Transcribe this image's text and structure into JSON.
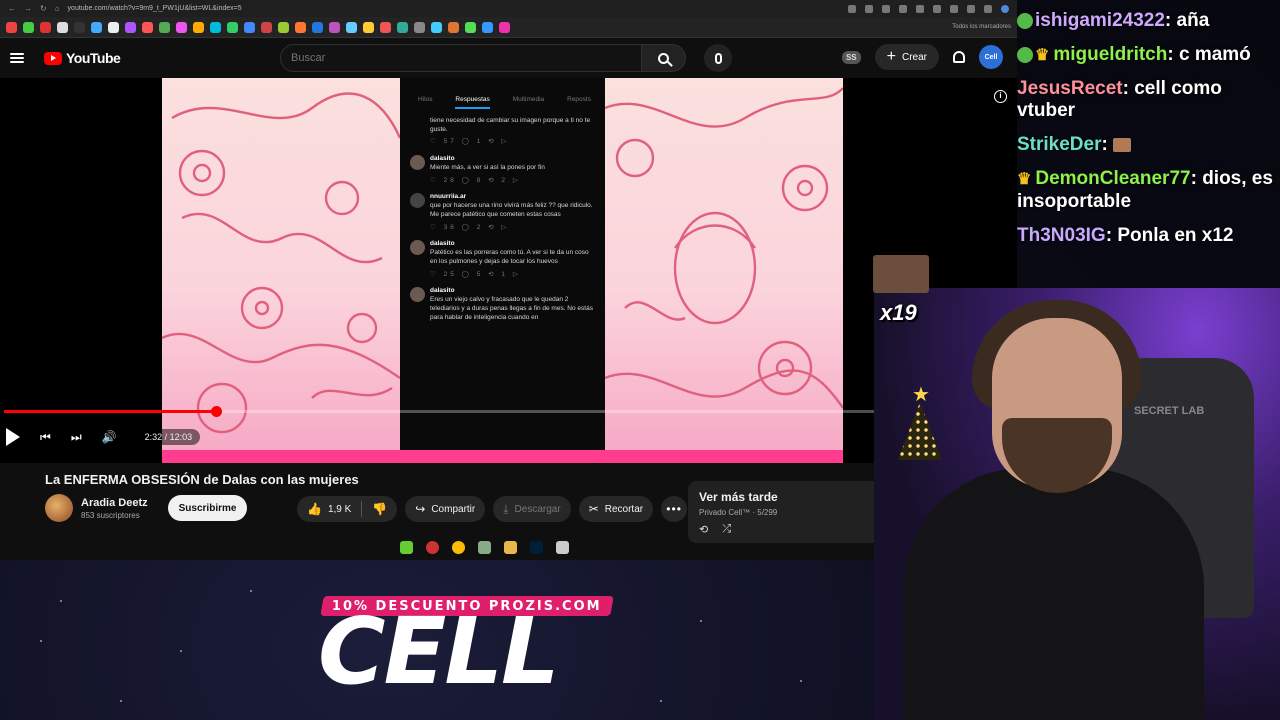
{
  "browser": {
    "url": "youtube.com/watch?v=9m9_t_PW1jU&list=WL&index=5",
    "bookmarks_all": "Todos los marcadores"
  },
  "yt": {
    "logo_text": "YouTube",
    "search_placeholder": "Buscar",
    "ss_badge": "SS",
    "create_label": "Crear",
    "avatar_text": "Cell"
  },
  "player": {
    "time": "2:32 / 12:03",
    "progress": 0.21
  },
  "tweet_panel": {
    "tabs": [
      "Hilos",
      "Respuestas",
      "Multimedia",
      "Reposts"
    ],
    "posts": [
      {
        "handle": "",
        "text": "tiene necesidad de cambiar su imagen porque a ti no te guste.",
        "acts": "♡ 57  ◯ 1  ⟲  ▷"
      },
      {
        "handle": "dalasito",
        "text": "Miente más, a ver si así la pones por fin",
        "acts": "♡ 28  ◯ 8  ⟲ 2  ▷"
      },
      {
        "handle": "nnuurriia.ar",
        "text": "que por hacerse una rino vivirá más feliz ?? que ridiculo. Me parece patético que cometen estas cosas",
        "acts": "♡ 36  ◯ 2  ⟲  ▷"
      },
      {
        "handle": "dalasito",
        "text": "Patético es las porreras como tú. A ver si te da un coso en los pulmones y dejas de tocar los huevos",
        "acts": "♡ 25  ◯ 5  ⟲ 1  ▷"
      },
      {
        "handle": "dalasito",
        "text": "Eres un viejo calvo y fracasado que le quedan 2 telediarios y a duras penas llegas a fin de mes. No estás para hablar de inteligencia cuando en",
        "acts": ""
      }
    ]
  },
  "video": {
    "title": "La ENFERMA OBSESIÓN de Dalas con las mujeres",
    "channel": "Aradia Deetz",
    "subscribers": "853 suscriptores",
    "subscribe_label": "Suscribirme",
    "likes": "1,9 K",
    "share_label": "Compartir",
    "download_label": "Descargar",
    "clip_label": "Recortar"
  },
  "playlist": {
    "title": "Ver más tarde",
    "sub": "Privado Cell™ · 5/299"
  },
  "chat": [
    {
      "user": "ishigami24322",
      "color": "#cfa8ff",
      "badge": "green",
      "message": "añа"
    },
    {
      "user": "migueldritch",
      "color": "#8ef04a",
      "badge": "green-crown",
      "message": "c mamó"
    },
    {
      "user": "JesusRecet",
      "color": "#ff8f9b",
      "badge": "",
      "message": "cell como vtuber"
    },
    {
      "user": "StrikeDer",
      "color": "#6ae0c8",
      "badge": "",
      "message": ""
    },
    {
      "user": "DemonCleaner77",
      "color": "#8ef04a",
      "badge": "crown",
      "message": "dios, es insoportable"
    },
    {
      "user": "Th3N03IG",
      "color": "#c9a8ff",
      "badge": "",
      "message": "Ponla en x12"
    }
  ],
  "overlay": {
    "sticker_text": "x19",
    "promo_tag": "10% DESCUENTO PROZIS.COM",
    "brand": "CELL",
    "chair_logo": "SECRET LAB"
  }
}
